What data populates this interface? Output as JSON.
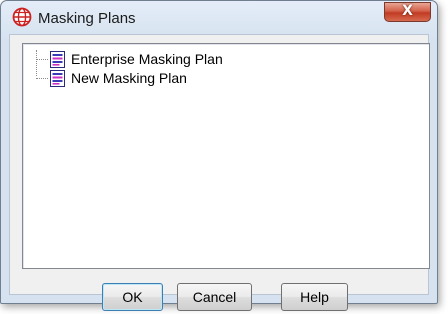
{
  "window": {
    "title": "Masking Plans",
    "close_label": "X"
  },
  "tree": {
    "items": [
      {
        "label": "Enterprise Masking Plan",
        "icon": "document-icon"
      },
      {
        "label": "New Masking Plan",
        "icon": "document-icon"
      }
    ]
  },
  "buttons": {
    "ok": "OK",
    "cancel": "Cancel",
    "help": "Help"
  },
  "colors": {
    "app_icon": "#cc2222",
    "close_button": "#c8452e",
    "tree_background": "#ffffff",
    "dialog_background": "#f0f0f0"
  }
}
